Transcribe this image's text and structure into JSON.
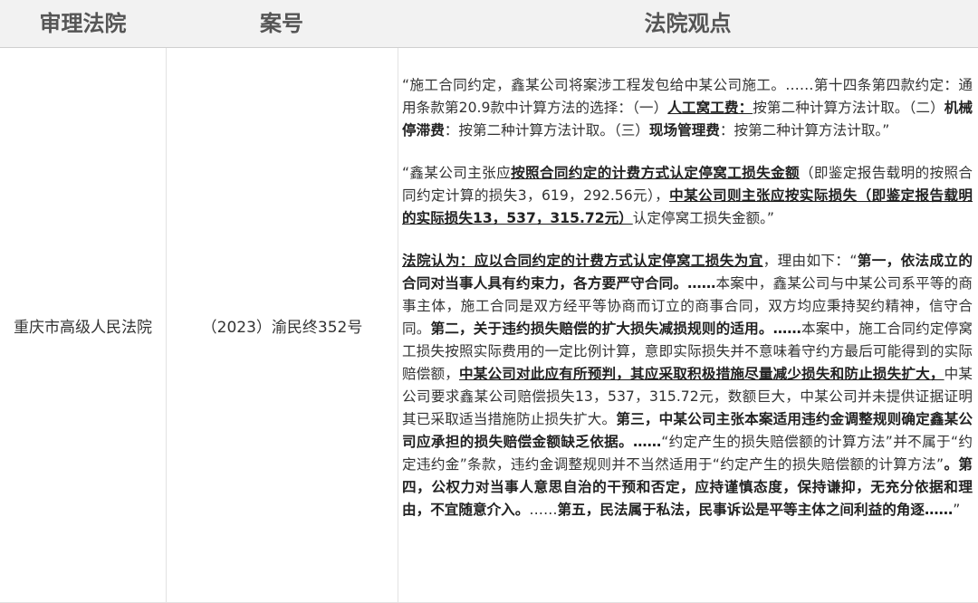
{
  "table": {
    "headers": {
      "court": "审理法院",
      "case_no": "案号",
      "view": "法院观点"
    },
    "row": {
      "court": "重庆市高级人民法院",
      "case_no": "（2023）渝民终352号",
      "paragraphs": [
        [
          {
            "t": "“施工合同约定，鑫某公司将案涉工程发包给中某公司施工。……第十四条第四款约定：通用条款第20.9款中计算方法的选择：（一）",
            "s": "n"
          },
          {
            "t": "人工窝工费：",
            "s": "bu"
          },
          {
            "t": "按第二种计算方法计取。（二）",
            "s": "n"
          },
          {
            "t": "机械停滞费",
            "s": "b"
          },
          {
            "t": "：按第二种计算方法计取。（三）",
            "s": "n"
          },
          {
            "t": "现场管理费",
            "s": "b"
          },
          {
            "t": "：按第二种计算方法计取。”",
            "s": "n"
          }
        ],
        [
          {
            "t": "“鑫某公司主张应",
            "s": "n"
          },
          {
            "t": "按照合同约定的计费方式认定停窝工损失金额",
            "s": "bu"
          },
          {
            "t": "（即鉴定报告载明的按照合同约定计算的损失3，619，292.56元），",
            "s": "n"
          },
          {
            "t": "中某公司则主张应按实际损失（即鉴定报告载明的实际损失13，537，315.72元）",
            "s": "bu"
          },
          {
            "t": "认定停窝工损失金额。”",
            "s": "n"
          }
        ],
        [
          {
            "t": "法院认为：应以合同约定的计费方式认定停窝工损失为宜",
            "s": "bu"
          },
          {
            "t": "，理由如下：“",
            "s": "n"
          },
          {
            "t": "第一，依法成立的合同对当事人具有约束力，各方要严守合同。……",
            "s": "b"
          },
          {
            "t": "本案中，鑫某公司与中某公司系平等的商事主体，施工合同是双方经平等协商而订立的商事合同，双方均应秉持契约精神，信守合同。",
            "s": "n"
          },
          {
            "t": "第二，关于违约损失赔偿的扩大损失减损规则的适用。……",
            "s": "b"
          },
          {
            "t": "本案中，施工合同约定停窝工损失按照实际费用的一定比例计算，意即实际损失并不意味着守约方最后可能得到的实际赔偿额，",
            "s": "n"
          },
          {
            "t": "中某公司对此应有所预判，其应采取积极措施尽量减少损失和防止损失扩大，",
            "s": "bu"
          },
          {
            "t": "中某公司要求鑫某公司赔偿损失13，537，315.72元，数额巨大，中某公司并未提供证据证明其已采取适当措施防止损失扩大。",
            "s": "n"
          },
          {
            "t": "第三，中某公司主张本案适用违约金调整规则确定鑫某公司应承担的损失赔偿金额缺乏依据。……",
            "s": "b"
          },
          {
            "t": "“约定产生的损失赔偿额的计算方法”并不属于“约定违约金”条款，违约金调整规则并不当然适用于“约定产生的损失赔偿额的计算方法”",
            "s": "n"
          },
          {
            "t": "。第四，公权力对当事人意思自治的干预和否定，应持谨慎态度，保持谦抑，无充分依据和理由，不宜随意介入。",
            "s": "b"
          },
          {
            "t": "……",
            "s": "n"
          },
          {
            "t": "第五，民法属于私法，民事诉讼是平等主体之间利益的角逐……",
            "s": "b"
          },
          {
            "t": "”",
            "s": "n"
          }
        ]
      ]
    }
  }
}
